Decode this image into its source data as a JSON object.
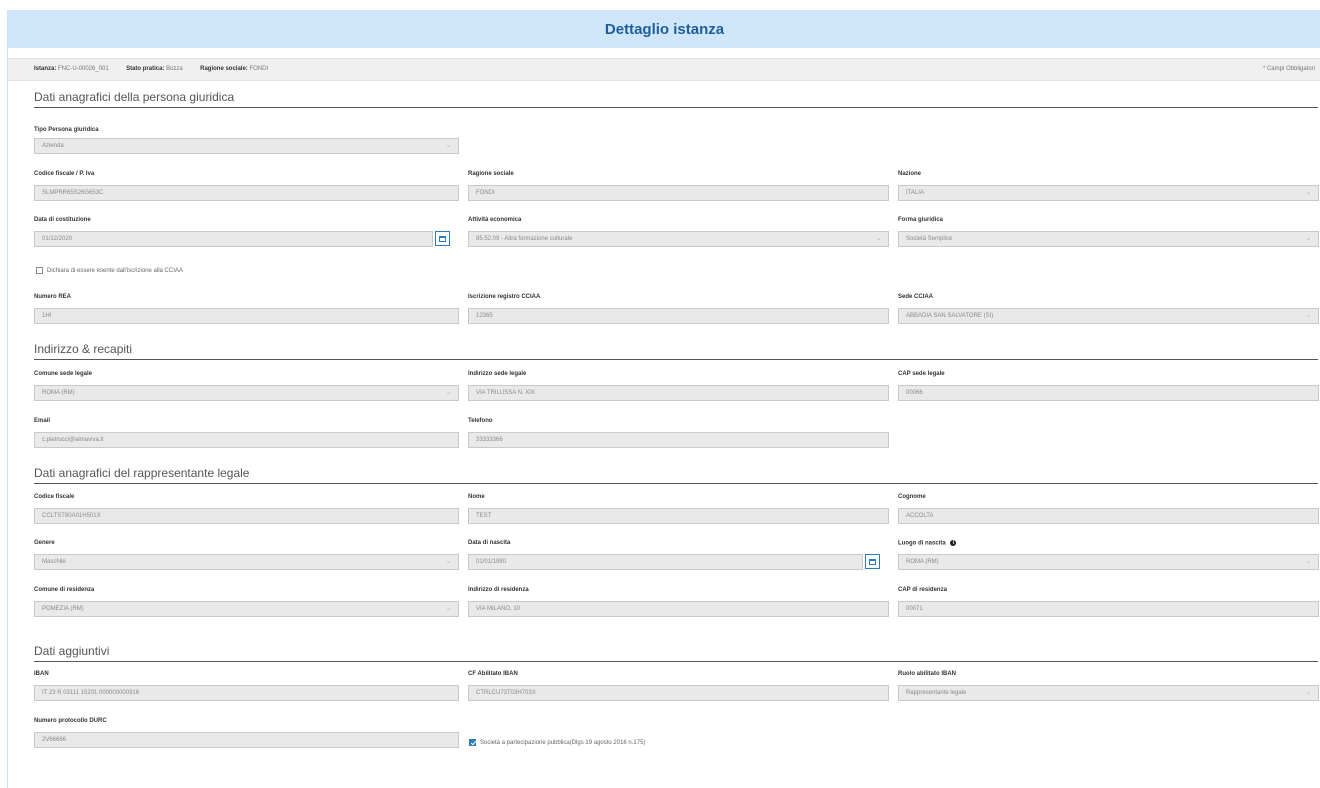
{
  "page": {
    "title": "Dettaglio istanza"
  },
  "info": {
    "istanza_label": "Istanza:",
    "istanza_value": "FNC-U-00026_001",
    "stato_label": "Stato pratica:",
    "stato_value": "Bozza",
    "ragione_label": "Ragione sociale:",
    "ragione_value": "FONDI",
    "required_note": "* Campi Obbligatori"
  },
  "sections": {
    "persona_giuridica": "Dati anagrafici della persona giuridica",
    "indirizzo": "Indirizzo & recapiti",
    "rappresentante": "Dati anagrafici del rappresentante legale",
    "aggiuntivi": "Dati aggiuntivi"
  },
  "fields": {
    "tipo_persona": {
      "label": "Tipo Persona giuridica",
      "value": "Azienda"
    },
    "codice_fiscale_piva": {
      "label": "Codice fiscale / P. Iva",
      "value": "SLMPRR65S26G653C"
    },
    "ragione_sociale": {
      "label": "Ragione sociale",
      "value": "FONDI"
    },
    "nazione": {
      "label": "Nazione",
      "value": "ITALIA"
    },
    "data_costituzione": {
      "label": "Data di costituzione",
      "value": "01/12/2020"
    },
    "attivita_economica": {
      "label": "Attività economica",
      "value": "85.52.09 - Altra formazione culturale"
    },
    "forma_giuridica": {
      "label": "Forma giuridica",
      "value": "Società Semplice"
    },
    "esente_ccia": {
      "label": "Dichiara di essere esente dall'iscrizione alla CCIAA"
    },
    "numero_rea": {
      "label": "Numero REA",
      "value": "1HI"
    },
    "iscrizione_ccia": {
      "label": "Iscrizione registro CCIAA",
      "value": "12365"
    },
    "sede_ccia": {
      "label": "Sede CCIAA",
      "value": "ABBADIA SAN SALVATORE (SI)"
    },
    "comune_sede": {
      "label": "Comune sede legale",
      "value": "ROMA (RM)"
    },
    "indirizzo_sede": {
      "label": "Indirizzo sede legale",
      "value": "VIA TRILUSSA N. XIX"
    },
    "cap_sede": {
      "label": "CAP sede legale",
      "value": "00066"
    },
    "email": {
      "label": "Email",
      "value": "c.pietrucci@almaviva.it"
    },
    "telefono": {
      "label": "Telefono",
      "value": "33333366"
    },
    "codice_fiscale": {
      "label": "Codice fiscale",
      "value": "CCLTST80A01H501X"
    },
    "nome": {
      "label": "Nome",
      "value": "TEST"
    },
    "cognome": {
      "label": "Cognome",
      "value": "ACCOLTA"
    },
    "genere": {
      "label": "Genere",
      "value": "Maschile"
    },
    "data_nascita": {
      "label": "Data di nascita",
      "value": "01/01/1980"
    },
    "luogo_nascita": {
      "label": "Luogo di nascita",
      "value": "ROMA (RM)"
    },
    "comune_residenza": {
      "label": "Comune di residenza",
      "value": "POMEZIA (RM)"
    },
    "indirizzo_residenza": {
      "label": "Indirizzo di residenza",
      "value": "VIA MILANO, 10"
    },
    "cap_residenza": {
      "label": "CAP di residenza",
      "value": "00071"
    },
    "iban": {
      "label": "IBAN",
      "value": "IT 23 R 03111 15201 000000000916"
    },
    "cf_abilitato_iban": {
      "label": "CF Abilitato IBAN",
      "value": "CTRLCU73T03H703X"
    },
    "ruolo_abilitato_iban": {
      "label": "Ruolo abilitato IBAN",
      "value": "Rappresentante legale"
    },
    "protocollo_durc": {
      "label": "Numero protocollo DURC",
      "value": "2V66666"
    },
    "partecipazione_pubblica": {
      "label": "Società a partecipazione pubblica(Dlgs 19 agosto 2016 n.175)",
      "checked": true
    }
  },
  "icons": {
    "select_caret": "chevron-down-icon",
    "calendar": "calendar-icon",
    "info": "info-icon",
    "info_glyph": "i",
    "caret_glyph": "⌄"
  },
  "colors": {
    "title_bar": "#d0e6fb",
    "title_text": "#1f5f99",
    "accent": "#2f7bbf"
  }
}
